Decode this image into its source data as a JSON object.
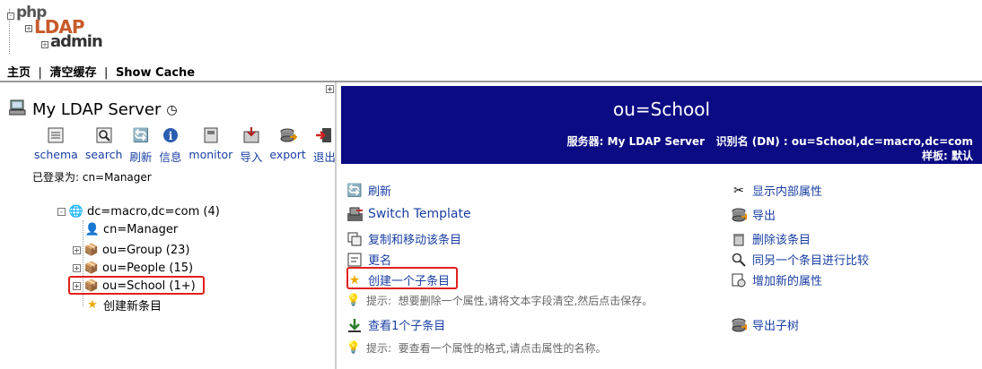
{
  "logo": {
    "php": "php",
    "ldap": "LDAP",
    "admin": "admin"
  },
  "topmenu": {
    "home": "主页",
    "purge": "清空缓存",
    "show_cache": "Show Cache",
    "separator": "|"
  },
  "left": {
    "server_name": "My LDAP Server",
    "tools": [
      {
        "label": "schema",
        "icon": "schema-icon"
      },
      {
        "label": "search",
        "icon": "search-icon"
      },
      {
        "label": "刷新",
        "icon": "refresh-icon"
      },
      {
        "label": "信息",
        "icon": "info-icon"
      },
      {
        "label": "monitor",
        "icon": "monitor-icon"
      },
      {
        "label": "导入",
        "icon": "import-icon"
      },
      {
        "label": "export",
        "icon": "export-icon"
      },
      {
        "label": "退出",
        "icon": "logout-icon"
      }
    ],
    "logged_in_label": "已登录为: cn=Manager",
    "tree": {
      "root": "dc=macro,dc=com (4)",
      "children": [
        {
          "label": "cn=Manager",
          "expand": ""
        },
        {
          "label": "ou=Group (23)",
          "expand": "+"
        },
        {
          "label": "ou=People (15)",
          "expand": "+"
        },
        {
          "label": "ou=School (1+)",
          "expand": "+"
        }
      ],
      "create_new": "创建新条目"
    }
  },
  "right": {
    "rdn": "ou=School",
    "meta_line1": "服务器: My LDAP Server   识别名 (DN) : ou=School,dc=macro,dc=com",
    "meta_line2": "样板: 默认",
    "actions_left": [
      {
        "label": "刷新",
        "icon": "refresh-icon"
      },
      {
        "label": "Switch Template",
        "icon": "switch-template-icon"
      },
      {
        "label": "复制和移动该条目",
        "icon": "copy-icon"
      },
      {
        "label": "更名",
        "icon": "rename-icon"
      },
      {
        "label": "创建一个子条目",
        "icon": "star-icon"
      }
    ],
    "hint1": "提示:  想要删除一个属性,请将文本字段清空,然后点击保存。",
    "view_children": "查看1个子条目",
    "hint2": "提示:  要查看一个属性的格式,请点击属性的名称。",
    "actions_right": [
      {
        "label": "显示内部属性",
        "icon": "tools-icon"
      },
      {
        "label": "导出",
        "icon": "export-icon"
      },
      {
        "label": "删除该条目",
        "icon": "trash-icon"
      },
      {
        "label": "同另一个条目进行比较",
        "icon": "compare-icon"
      },
      {
        "label": "增加新的属性",
        "icon": "add-attribute-icon"
      }
    ],
    "export_subtree": "导出子树"
  },
  "colors": {
    "header_bg": "#0b0b84",
    "link": "#1a3fa3",
    "highlight": "#e0201c"
  }
}
